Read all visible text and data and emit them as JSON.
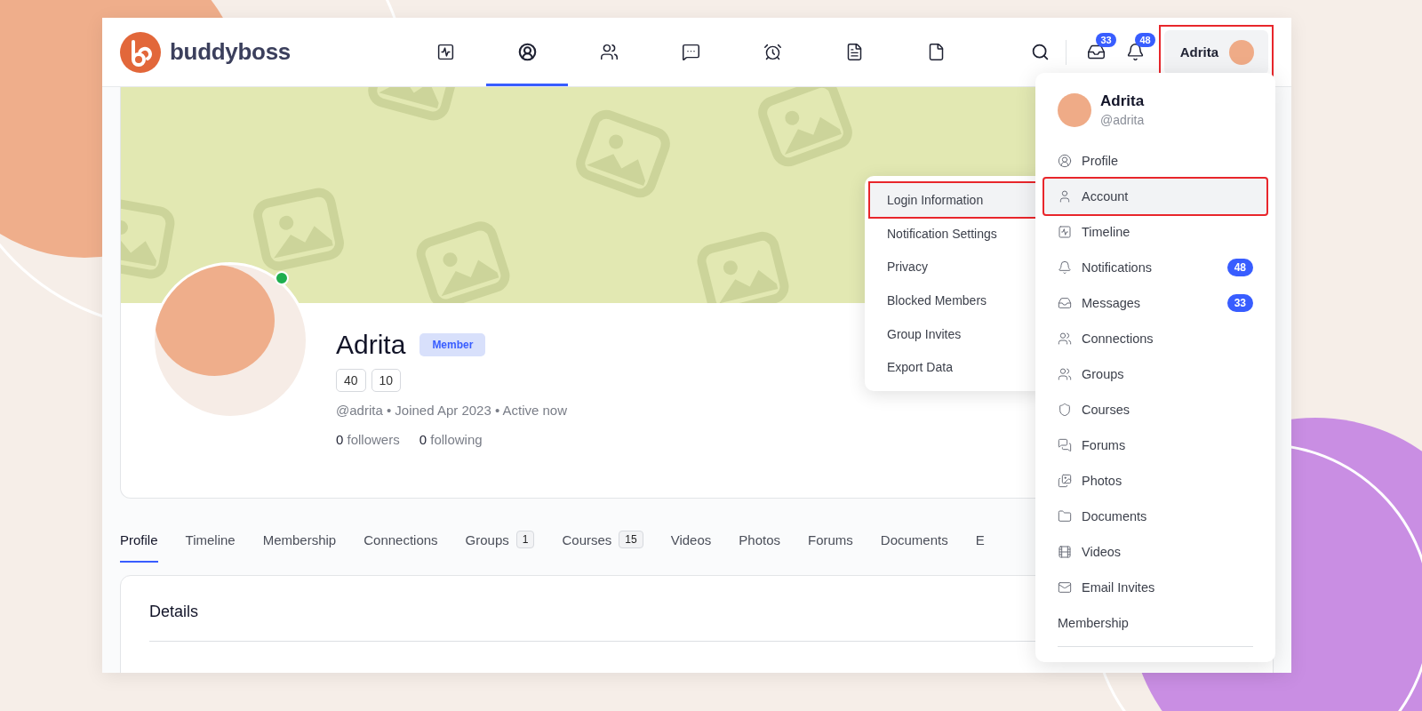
{
  "logo": {
    "text": "buddyboss"
  },
  "nav": [
    {
      "selected": false
    },
    {
      "selected": true
    },
    {
      "selected": false
    },
    {
      "selected": false
    },
    {
      "selected": false
    },
    {
      "selected": false
    },
    {
      "selected": false
    }
  ],
  "header_actions": {
    "inbox_count": "33",
    "notification_count": "48"
  },
  "user_button": {
    "name": "Adrita",
    "highlighted": true
  },
  "profile": {
    "name": "Adrita",
    "online": true,
    "badge": "Member",
    "counts": [
      "40",
      "10"
    ],
    "meta": "@adrita • Joined Apr 2023 • Active now",
    "followers": {
      "count": "0",
      "label": "followers"
    },
    "following": {
      "count": "0",
      "label": "following"
    }
  },
  "tabs": [
    {
      "label": "Profile",
      "selected": true
    },
    {
      "label": "Timeline",
      "selected": false
    },
    {
      "label": "Membership",
      "selected": false
    },
    {
      "label": "Connections",
      "selected": false
    },
    {
      "label": "Groups",
      "count": "1",
      "selected": false
    },
    {
      "label": "Courses",
      "count": "15",
      "selected": false
    },
    {
      "label": "Videos",
      "selected": false
    },
    {
      "label": "Photos",
      "selected": false
    },
    {
      "label": "Forums",
      "selected": false
    },
    {
      "label": "Documents",
      "selected": false
    },
    {
      "label": "E",
      "selected": false
    }
  ],
  "details": {
    "title": "Details"
  },
  "account_submenu": [
    {
      "label": "Login Information",
      "selected": true
    },
    {
      "label": "Notification Settings",
      "selected": false
    },
    {
      "label": "Privacy",
      "selected": false
    },
    {
      "label": "Blocked Members",
      "selected": false
    },
    {
      "label": "Group Invites",
      "selected": false
    },
    {
      "label": "Export Data",
      "selected": false
    }
  ],
  "user_menu": {
    "name": "Adrita",
    "handle": "@adrita",
    "items": [
      {
        "kind": "icon",
        "label": "Profile",
        "selected": false
      },
      {
        "kind": "icon",
        "label": "Account",
        "selected": true
      },
      {
        "kind": "icon",
        "label": "Timeline",
        "selected": false
      },
      {
        "kind": "icon",
        "label": "Notifications",
        "count": "48",
        "selected": false
      },
      {
        "kind": "icon",
        "label": "Messages",
        "count": "33",
        "selected": false
      },
      {
        "kind": "icon",
        "label": "Connections",
        "selected": false
      },
      {
        "kind": "icon",
        "label": "Groups",
        "selected": false
      },
      {
        "kind": "icon",
        "label": "Courses",
        "selected": false
      },
      {
        "kind": "icon",
        "label": "Forums",
        "selected": false
      },
      {
        "kind": "icon",
        "label": "Photos",
        "selected": false
      },
      {
        "kind": "icon",
        "label": "Documents",
        "selected": false
      },
      {
        "kind": "icon",
        "label": "Videos",
        "selected": false
      },
      {
        "kind": "icon",
        "label": "Email Invites",
        "selected": false
      },
      {
        "kind": "plain",
        "label": "Membership",
        "selected": false
      }
    ]
  }
}
